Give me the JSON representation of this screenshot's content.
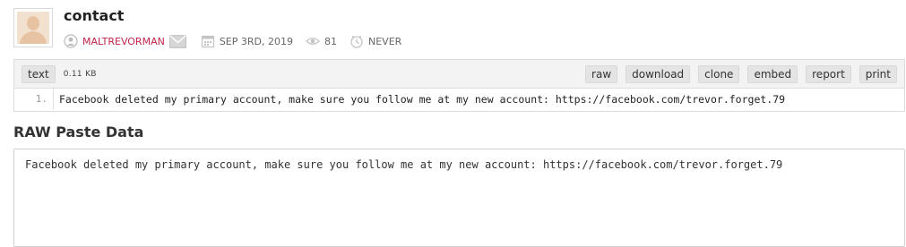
{
  "paste": {
    "title": "contact",
    "author": "MALTREVORMAN",
    "date": "SEP 3RD, 2019",
    "views": "81",
    "expiry": "NEVER"
  },
  "toolbar": {
    "syntax": "text",
    "size": "0.11 KB",
    "buttons": [
      "raw",
      "download",
      "clone",
      "embed",
      "report",
      "print"
    ]
  },
  "code": {
    "lines": [
      {
        "num": "1.",
        "text": "Facebook deleted my primary account, make sure you follow me at my new account: https://facebook.com/trevor.forget.79"
      }
    ]
  },
  "raw": {
    "heading": "RAW Paste Data",
    "text": "Facebook deleted my primary account, make sure you follow me at my new account: https://facebook.com/trevor.forget.79"
  },
  "icons": {
    "user": "user-icon",
    "mail": "mail-icon",
    "calendar": "calendar-icon",
    "views": "eye-icon",
    "expiry": "clock-icon"
  }
}
